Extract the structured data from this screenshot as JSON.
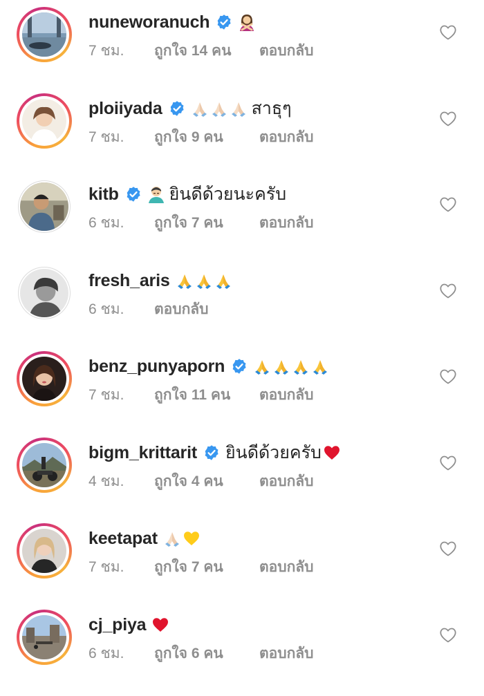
{
  "comments": [
    {
      "username": "nuneworanuch",
      "verified": true,
      "emojis": [
        "person-gesturing-no-emoji"
      ],
      "text": "",
      "time": "7 ชม.",
      "likes": "ถูกใจ 14 คน",
      "reply": "ตอบกลับ",
      "ring": true
    },
    {
      "username": "ploiiyada",
      "verified": true,
      "emojis": [
        "folded-hands-light-emoji",
        "folded-hands-light-emoji",
        "folded-hands-light-emoji"
      ],
      "text": "สาธุๆ",
      "time": "7 ชม.",
      "likes": "ถูกใจ 9 คน",
      "reply": "ตอบกลับ",
      "ring": true
    },
    {
      "username": "kitb",
      "verified": true,
      "emojis": [
        "man-bowing-emoji"
      ],
      "text": "ยินดีด้วยนะครับ",
      "time": "6 ชม.",
      "likes": "ถูกใจ 7 คน",
      "reply": "ตอบกลับ",
      "ring": false
    },
    {
      "username": "fresh_aris",
      "verified": false,
      "emojis": [
        "folded-hands-emoji",
        "folded-hands-emoji",
        "folded-hands-emoji"
      ],
      "text": "",
      "time": "6 ชม.",
      "likes": "",
      "reply": "ตอบกลับ",
      "ring": false
    },
    {
      "username": "benz_punyaporn",
      "verified": true,
      "emojis": [
        "folded-hands-emoji",
        "folded-hands-emoji",
        "folded-hands-emoji",
        "folded-hands-emoji"
      ],
      "text": "",
      "time": "7 ชม.",
      "likes": "ถูกใจ 11 คน",
      "reply": "ตอบกลับ",
      "ring": true
    },
    {
      "username": "bigm_krittarit",
      "verified": true,
      "emojis": [],
      "text": "ยินดีด้วยครับ",
      "trailing_emoji": "red-heart-emoji",
      "time": "4 ชม.",
      "likes": "ถูกใจ 4 คน",
      "reply": "ตอบกลับ",
      "ring": true
    },
    {
      "username": "keetapat",
      "verified": false,
      "emojis": [
        "folded-hands-light-emoji",
        "yellow-heart-emoji"
      ],
      "text": "",
      "time": "7 ชม.",
      "likes": "ถูกใจ 7 คน",
      "reply": "ตอบกลับ",
      "ring": true
    },
    {
      "username": "cj_piya",
      "verified": false,
      "emojis": [
        "red-heart-emoji"
      ],
      "text": "",
      "time": "6 ชม.",
      "likes": "ถูกใจ 6 คน",
      "reply": "ตอบกลับ",
      "ring": true
    }
  ],
  "icons": {
    "verified": "verified-badge-icon",
    "like": "heart-outline-icon"
  },
  "colors": {
    "username": "#262626",
    "meta": "#8e8e8e",
    "verified": "#3897f0",
    "ring_start": "#f9a23a",
    "ring_end": "#c9307d"
  }
}
